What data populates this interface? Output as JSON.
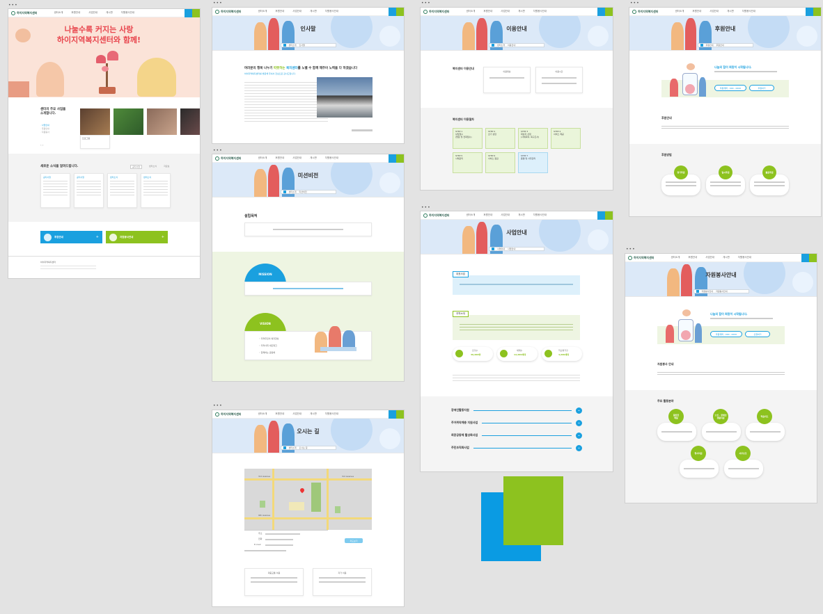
{
  "header": {
    "logo": "하이지역복지센터",
    "nav": [
      "센터소개",
      "후원안내",
      "사업안내",
      "게시판",
      "자원봉사안내"
    ]
  },
  "home": {
    "hero_line1": "나눌수록 커지는 사랑",
    "hero_line2": "하이지역복지센터와 함께!",
    "intro_title": "센터의 주요 사업을\n소개합니다.",
    "intro_links": [
      "· 사업안내",
      "· 후원안내",
      "· 자원봉사"
    ],
    "card_caption": "프로그램",
    "news_title": "새로운 소식을 알려드립니다.",
    "news_tabs": [
      "공지사항",
      "센터소식",
      "자료실"
    ],
    "news_items": [
      "공지사항",
      "공지사항",
      "센터소식",
      "센터소식"
    ],
    "quick1": "후원안내",
    "quick2": "자원봉사안내",
    "footer": "하이지역복지센터"
  },
  "greeting": {
    "title": "인사말",
    "crumb1": "센터소개",
    "crumb2": "인사말",
    "lead": "여러분의 행복 나누기 ",
    "lead_hl1": "따뜻하는",
    "lead_mid": " ",
    "lead_hl2": "복지센터",
    "lead_end": "를 노벨 수 함께 해주어 노력을 다 하겠습니다",
    "sub": "하이지역복지센터를 방문해 주셔서 진심으로 감사드립니다."
  },
  "mission": {
    "title": "미션비전",
    "crumb1": "센터소개",
    "crumb2": "미션비전",
    "section": "설립목적",
    "mission": "MISSION",
    "vision": "VISION",
    "vision_items": [
      "지역주민의 복지향상",
      "지역사회 네트워크",
      "함께하는 공동체"
    ]
  },
  "location": {
    "title": "오시는 길",
    "crumb1": "센터소개",
    "crumb2": "오시는 길",
    "map_labels": [
      "3rd Avenue",
      "3rd Avenue",
      "9th Avenue"
    ],
    "info_labels": [
      "주소",
      "전화",
      "E-mail"
    ],
    "map_button": "지도보기",
    "box1": "대중교통 이용",
    "box2": "자가 이용"
  },
  "hours": {
    "title": "이용안내",
    "crumb1": "센터소개",
    "crumb2": "이용안내",
    "section1": "복지센터 이용안내",
    "col1": "이용대상",
    "col2": "이용시간",
    "section2": "복지센터 이용절차",
    "steps": [
      {
        "n": "STEP 1",
        "t": "상담접수\n(방문 및 전화접수)"
      },
      {
        "n": "STEP 2",
        "t": "초기 상담"
      },
      {
        "n": "STEP 3",
        "t": "대상자 선정\n(사례회의, 욕구조사)"
      },
      {
        "n": "STEP 4",
        "t": "서비스 제공"
      },
      {
        "n": "STEP 5",
        "t": "사례관리"
      },
      {
        "n": "STEP 6",
        "t": "서비스 점검"
      },
      {
        "n": "STEP 7",
        "t": "종결 및 사후관리"
      }
    ]
  },
  "business": {
    "title": "사업안내",
    "crumb1": "사업안내",
    "crumb2": "사업안내",
    "label1": "대표사업",
    "label2": "지역소개",
    "stats": [
      {
        "k": "인구수",
        "v": "30,000명"
      },
      {
        "k": "세대수",
        "v": "12,000세대"
      },
      {
        "k": "저소득가구",
        "v": "4,000세대"
      }
    ],
    "accordion": [
      "장애인활동지원",
      "주거취약계층 지원사업",
      "희망공동체 활성화사업",
      "주민조직화사업"
    ]
  },
  "donate": {
    "title": "후원안내",
    "crumb1": "후원안내",
    "crumb2": "후원안내",
    "hl": "나눔의 힘이 희망이 시작됩니다.",
    "acct": "후원계좌 : 000 - 0000",
    "btn": "후원하기",
    "sec1": "후원안내",
    "sec2": "후원방법",
    "methods": [
      "정기후원",
      "일시후원",
      "물품후원"
    ]
  },
  "volunteer": {
    "title": "자원봉사안내",
    "crumb1": "자원봉사안내",
    "crumb2": "자원봉사안내",
    "hl": "나눔의 힘이 희망이 시작됩니다.",
    "acct": "후원계좌 : 000 - 0000",
    "btn": "신청하기",
    "sec1": "자원봉사 안내",
    "sec2": "주요 활동분야",
    "areas": [
      "밑반찬\n배달",
      "노인 · 장애인\n생활지원",
      "학습지도",
      "행사지원",
      "사무보조"
    ]
  }
}
